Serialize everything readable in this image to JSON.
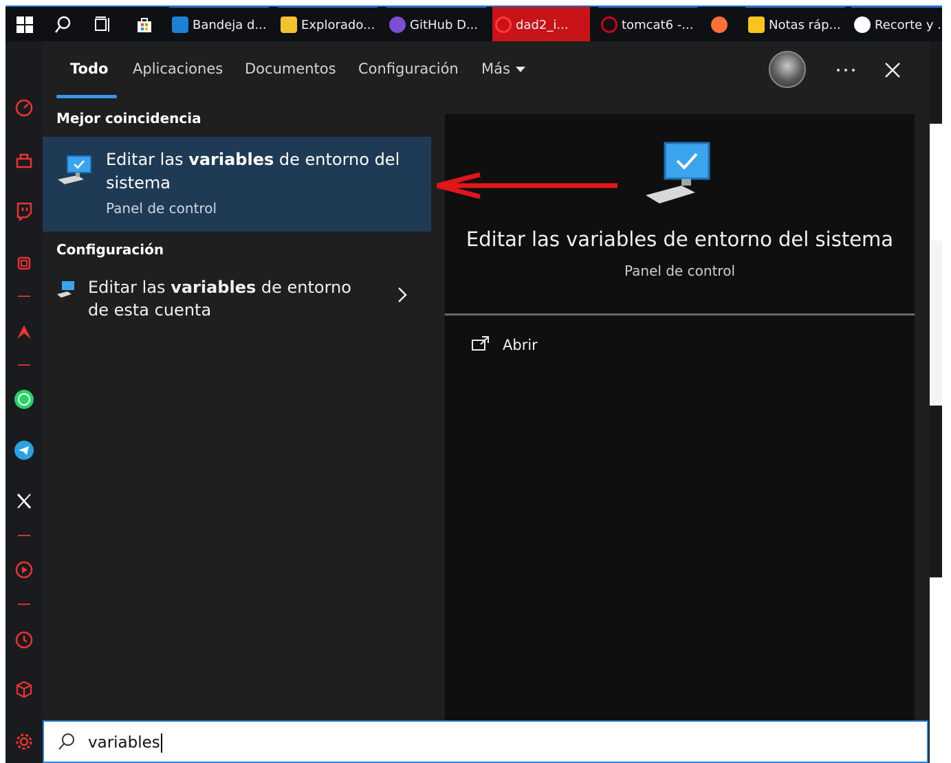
{
  "taskbar": {
    "apps": [
      {
        "label": "Bandeja d...",
        "icon": "mail-icon",
        "color": "#1e7fd6"
      },
      {
        "label": "Explorado...",
        "icon": "folder-icon",
        "color": "#f2c230"
      },
      {
        "label": "GitHub D...",
        "icon": "github-icon",
        "color": "#7a4fd0"
      },
      {
        "label": "dad2_i...",
        "icon": "opera-icon",
        "color": "#d0021b"
      },
      {
        "label": "tomcat6 -...",
        "icon": "opera-icon",
        "color": "#d0021b"
      },
      {
        "label": "",
        "icon": "firefox-icon",
        "color": "#ff7139"
      },
      {
        "label": "Notas ráp...",
        "icon": "sticky-notes-icon",
        "color": "#f7c51e"
      },
      {
        "label": "Recorte y ...",
        "icon": "snip-icon",
        "color": "#ffffff"
      }
    ]
  },
  "tabs": {
    "items": [
      "Todo",
      "Aplicaciones",
      "Documentos",
      "Configuración",
      "Más"
    ]
  },
  "results": {
    "best_match_heading": "Mejor coincidencia",
    "best_match": {
      "title_pre": "Editar las ",
      "title_bold": "variables",
      "title_post": " de entorno del sistema",
      "subtitle": "Panel de control"
    },
    "config_heading": "Configuración",
    "config_item": {
      "title_pre": "Editar las ",
      "title_bold": "variables",
      "title_post": " de entorno de esta cuenta"
    }
  },
  "preview": {
    "title": "Editar las variables de entorno del sistema",
    "subtitle": "Panel de control",
    "action_open": "Abrir"
  },
  "search": {
    "value": "variables"
  },
  "colors": {
    "accent": "#3a94e8",
    "selected_bg": "#1e3a54",
    "annotation_arrow": "#e0161b"
  }
}
